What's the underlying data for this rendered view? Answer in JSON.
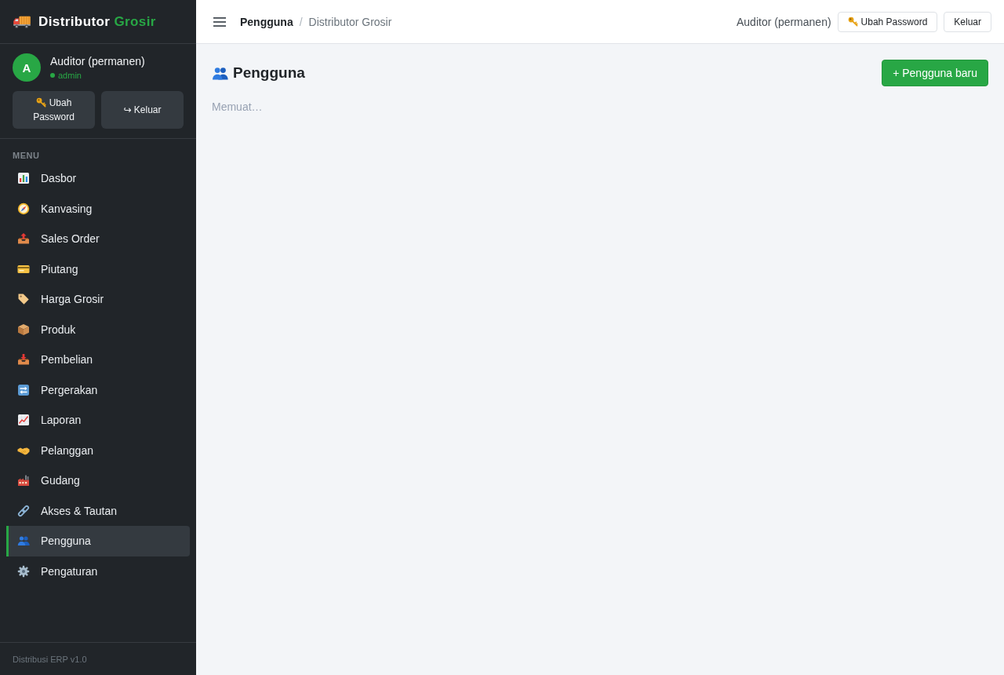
{
  "sidebar": {
    "brand": {
      "name": "Distributor",
      "accent": "Grosir"
    },
    "user": {
      "initial": "A",
      "name": "Auditor (permanen)",
      "role": "admin"
    },
    "buttons": [
      {
        "kind": "password",
        "label": "Ubah Password"
      },
      {
        "kind": "logout",
        "label": "↪ Keluar"
      }
    ],
    "menu": {
      "heading": "MENU",
      "items": [
        {
          "label": "Dasbor",
          "selected": false
        },
        {
          "label": "Kanvasing",
          "selected": false
        },
        {
          "label": "Sales Order",
          "selected": false
        },
        {
          "label": "Piutang",
          "selected": false
        },
        {
          "label": "Harga Grosir",
          "selected": false
        },
        {
          "label": "Produk",
          "selected": false
        },
        {
          "label": "Pembelian",
          "selected": false
        },
        {
          "label": "Pergerakan",
          "selected": false
        },
        {
          "label": "Laporan",
          "selected": false
        },
        {
          "label": "Pelanggan",
          "selected": false
        },
        {
          "label": "Gudang",
          "selected": false
        },
        {
          "label": "Akses & Tautan",
          "selected": false
        },
        {
          "label": "Pengguna",
          "selected": true
        },
        {
          "label": "Pengaturan",
          "selected": false
        }
      ]
    },
    "footer": "Distribusi ERP v1.0"
  },
  "topbar": {
    "breadcrumb": {
      "current": "Pengguna",
      "separator": "/",
      "parent": "Distributor Grosir"
    },
    "user_name": "Auditor (permanen)",
    "buttons": [
      {
        "kind": "password",
        "label": "Ubah Password"
      },
      {
        "kind": "logout",
        "label": "Keluar"
      }
    ]
  },
  "page": {
    "title": "Pengguna",
    "new_button": "+ Pengguna baru",
    "status": "Memuat…"
  }
}
